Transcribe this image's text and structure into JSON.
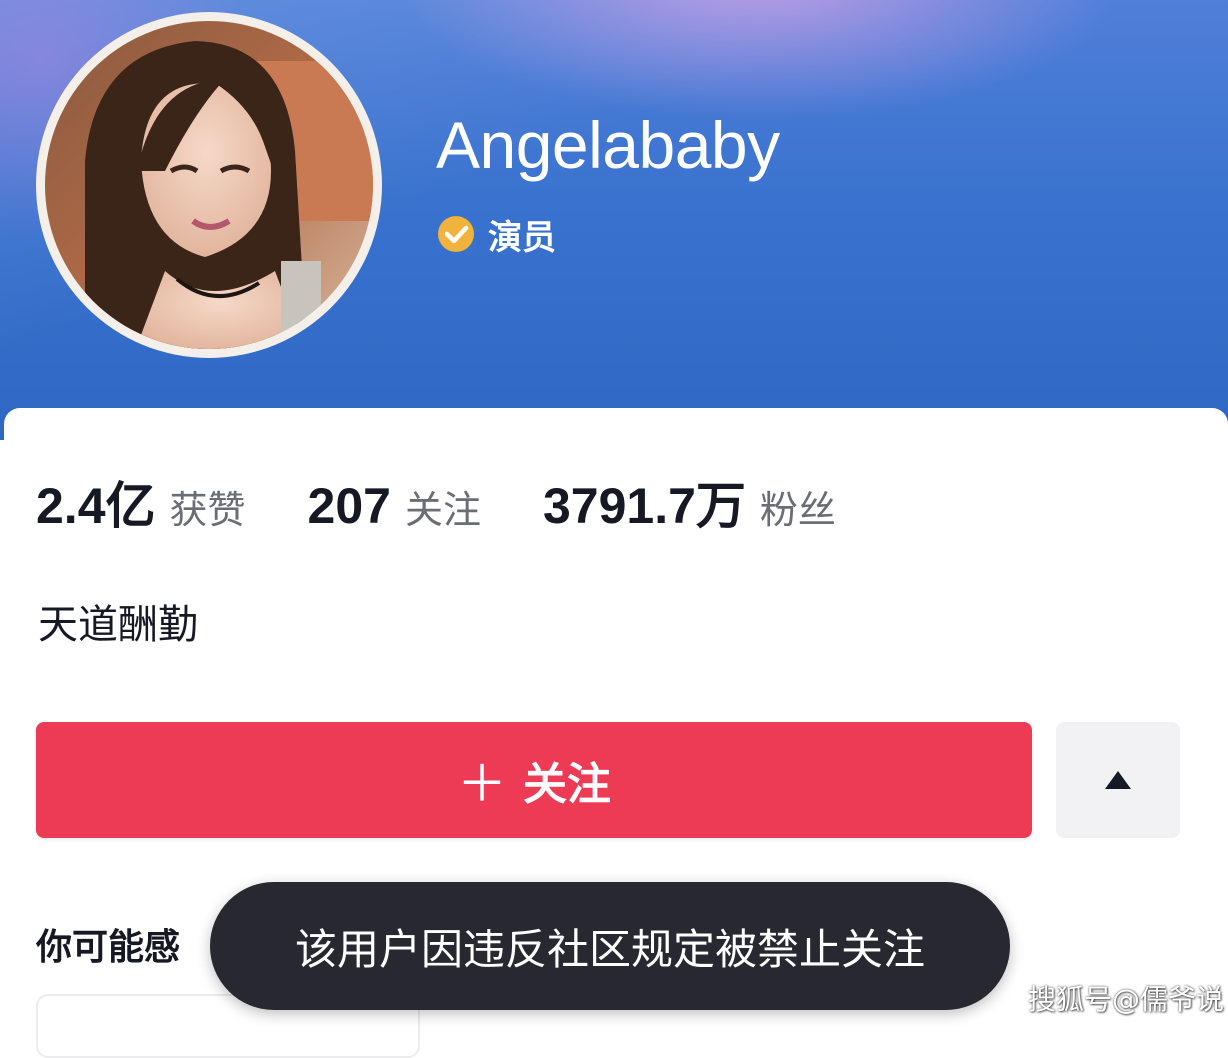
{
  "profile": {
    "name": "Angelababy",
    "verified_label": "演员",
    "bio": "天道酬勤"
  },
  "stats": [
    {
      "value": "2.4亿",
      "label": "获赞"
    },
    {
      "value": "207",
      "label": "关注"
    },
    {
      "value": "3791.7万",
      "label": "粉丝"
    }
  ],
  "actions": {
    "follow_plus": "＋",
    "follow_label": "关注",
    "more_icon": "triangle-up-icon"
  },
  "suggestions": {
    "label": "你可能感"
  },
  "toast": {
    "message": "该用户因违反社区规定被禁止关注"
  },
  "watermark": "搜狐号@儒爷说",
  "colors": {
    "header_blue": "#3a73cf",
    "follow_red": "#ee3b55",
    "verify_gold": "#f2b33d",
    "toast_bg": "#272830"
  }
}
